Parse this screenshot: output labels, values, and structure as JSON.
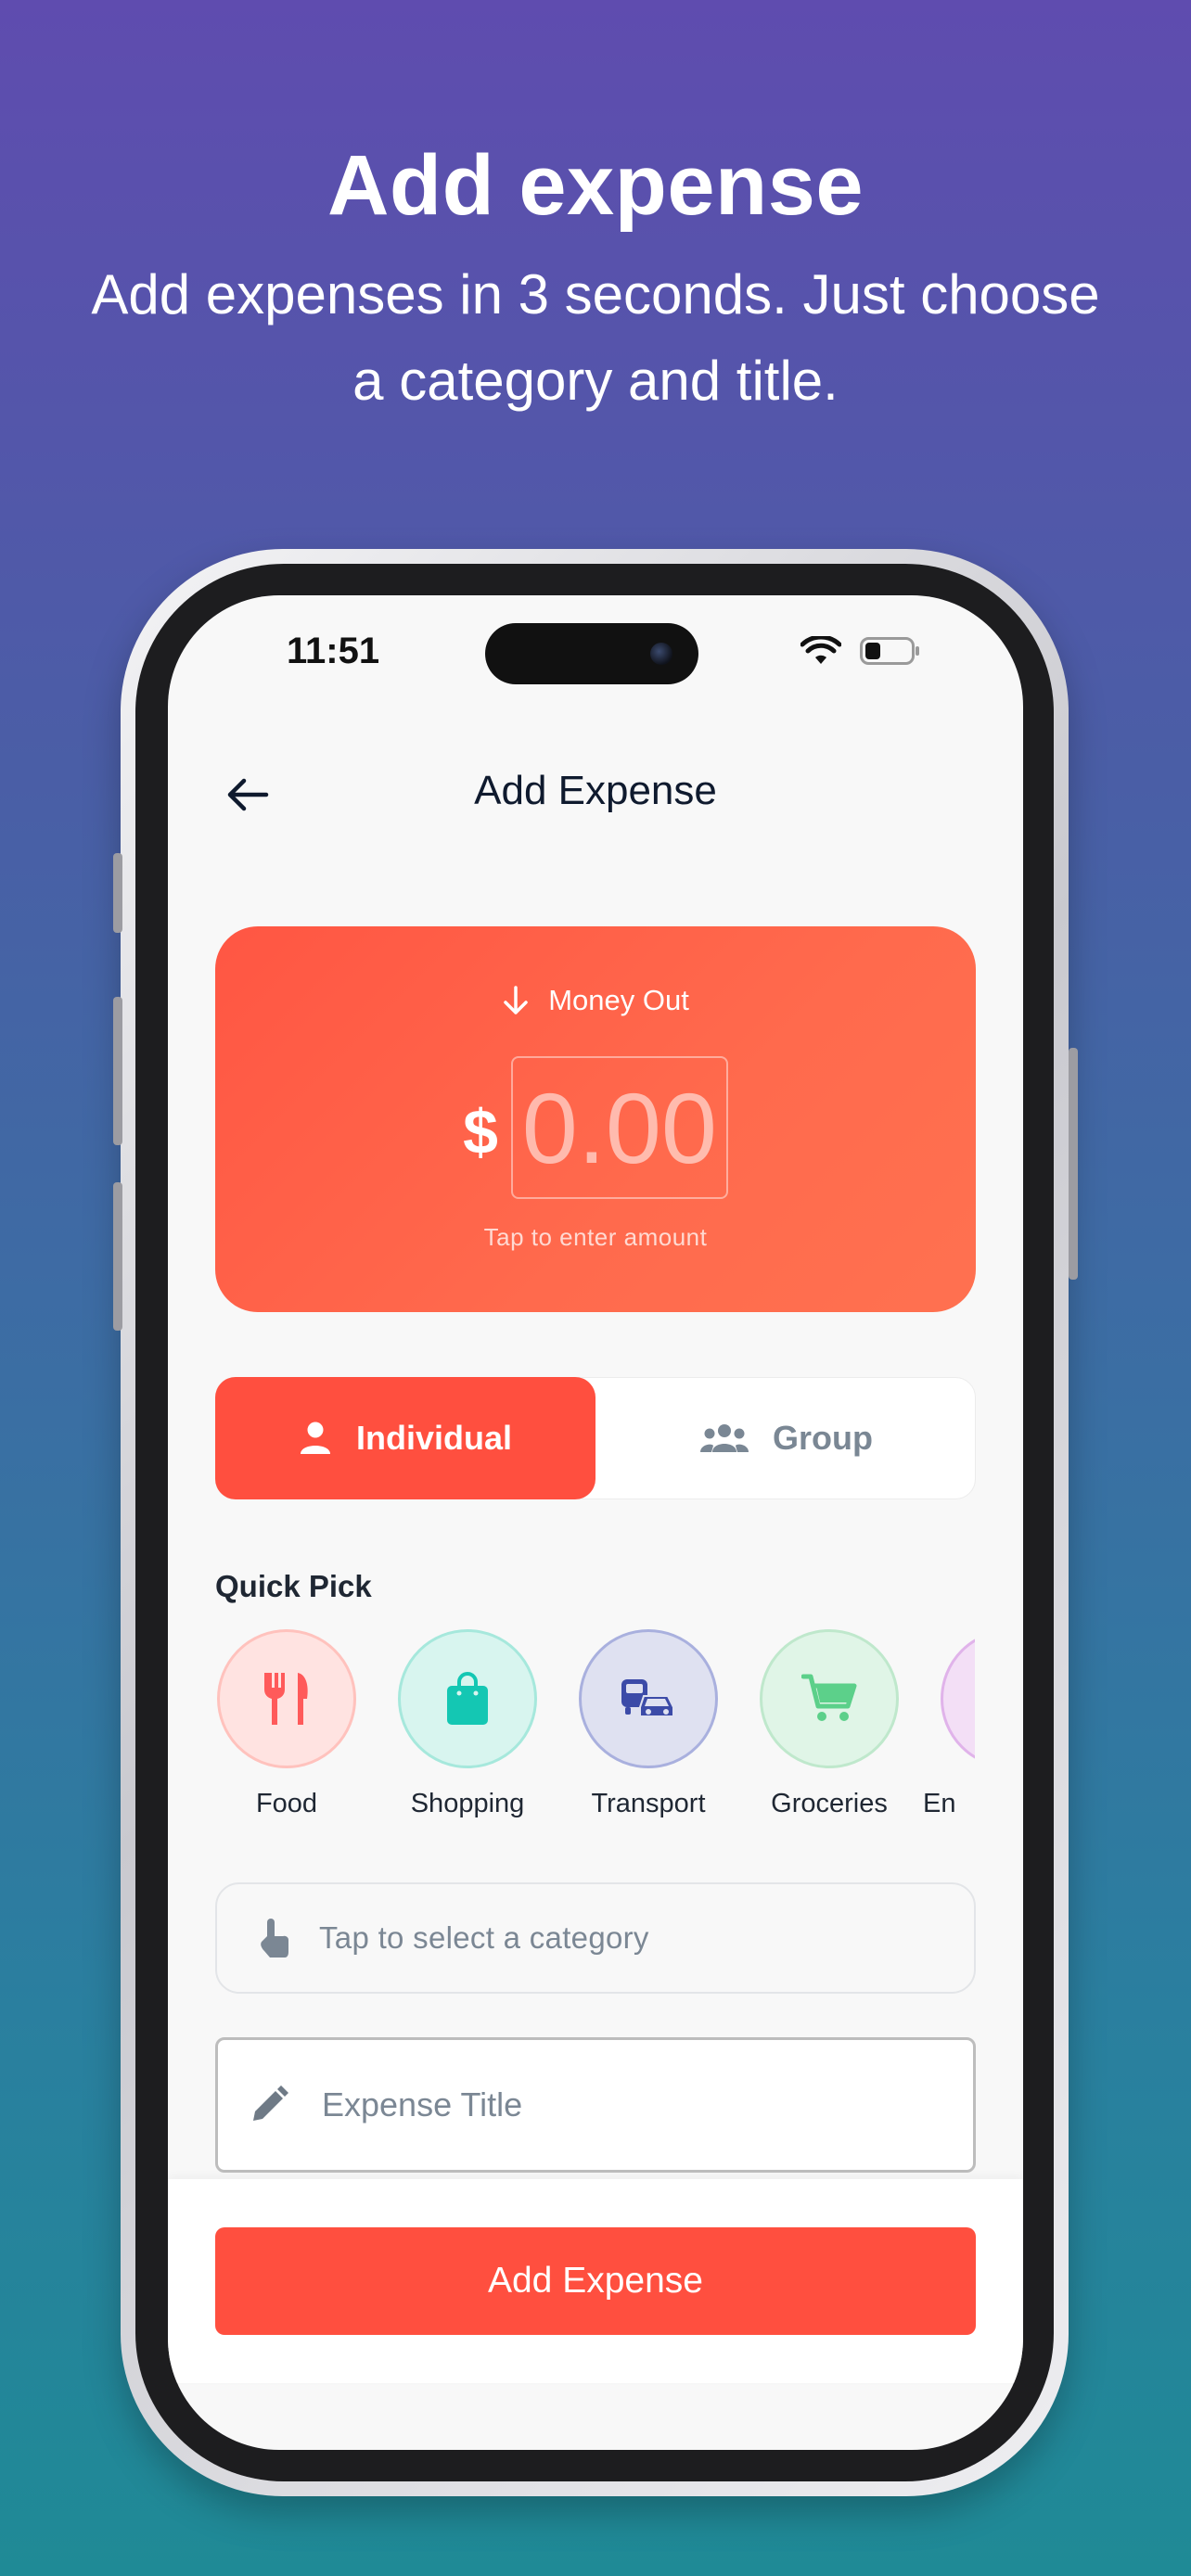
{
  "hero": {
    "title": "Add expense",
    "subtitle": "Add expenses in 3 seconds. Just choose a category and title."
  },
  "status_bar": {
    "time": "11:51",
    "icons": [
      "wifi-icon",
      "battery-icon"
    ]
  },
  "nav": {
    "back_icon": "arrow-left-icon",
    "title": "Add Expense"
  },
  "amount_card": {
    "direction_icon": "arrow-down-icon",
    "direction_label": "Money Out",
    "currency": "$",
    "amount_placeholder": "0.00",
    "hint": "Tap to enter amount",
    "color": "#ff5643"
  },
  "mode_toggle": {
    "selected": "Individual",
    "options": [
      {
        "label": "Individual",
        "icon": "person-icon"
      },
      {
        "label": "Group",
        "icon": "group-icon"
      }
    ]
  },
  "quick_pick": {
    "title": "Quick Pick",
    "items": [
      {
        "label": "Food",
        "icon": "utensils-icon",
        "color": "#ff5a5a"
      },
      {
        "label": "Shopping",
        "icon": "shopping-bag-icon",
        "color": "#14c7b3"
      },
      {
        "label": "Transport",
        "icon": "transport-icon",
        "color": "#3c4ba8"
      },
      {
        "label": "Groceries",
        "icon": "cart-icon",
        "color": "#5cd08a"
      },
      {
        "label": "En",
        "icon": "entertainment-icon",
        "color": "#c77ddb"
      }
    ]
  },
  "category_select": {
    "icon": "tap-hand-icon",
    "placeholder": "Tap to select a category"
  },
  "title_input": {
    "icon": "pencil-icon",
    "placeholder": "Expense Title",
    "value": ""
  },
  "submit": {
    "label": "Add Expense",
    "color": "#ff4f3f"
  }
}
